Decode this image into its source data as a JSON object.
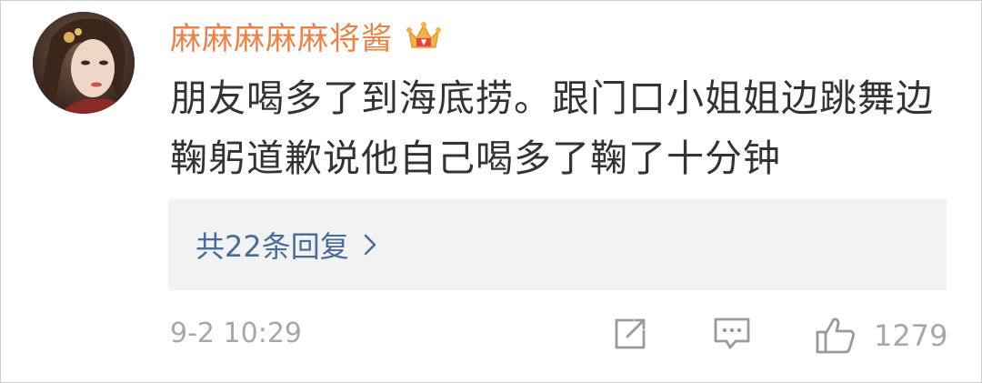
{
  "comment": {
    "username": "麻麻麻麻麻将酱",
    "badge_icon": "vip-crown-icon",
    "text": "朋友喝多了到海底捞。跟门口小姐姐边跳舞边鞠躬道歉说他自己喝多了鞠了十分钟",
    "replies_label": "共22条回复",
    "timestamp": "9-2 10:29",
    "like_count": "1279"
  },
  "colors": {
    "username": "#e8824a",
    "text": "#333333",
    "link": "#4a6a9a",
    "meta": "#a8a8a8",
    "reply_bg": "#f2f2f2"
  },
  "icons": {
    "share": "share-icon",
    "comment": "comment-icon",
    "like": "thumbs-up-icon",
    "chevron": "chevron-right-icon"
  }
}
